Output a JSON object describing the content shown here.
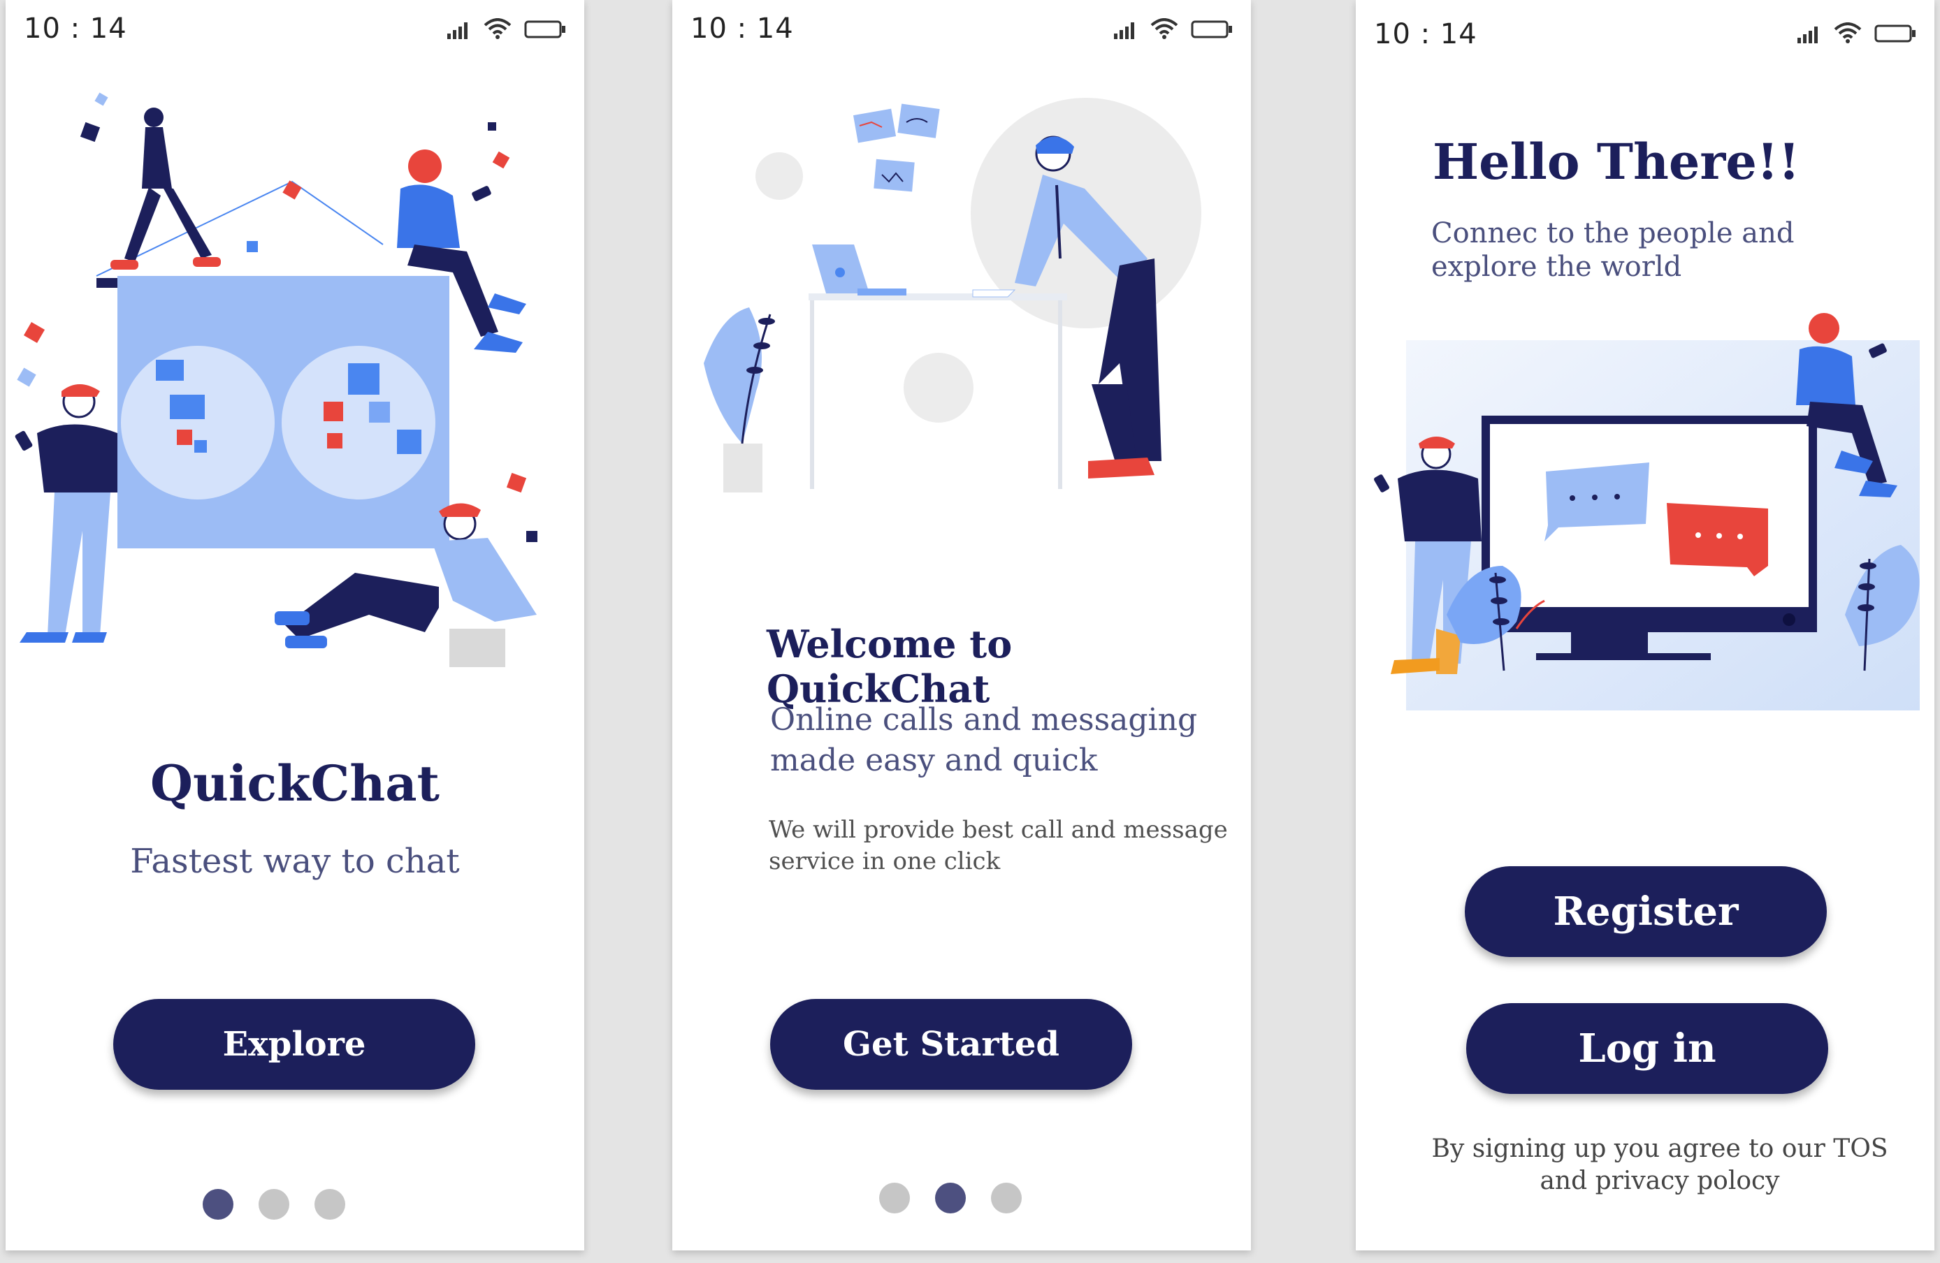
{
  "colors": {
    "primary": "#1c1f5b",
    "accent_blue": "#9cbcf5",
    "accent_red": "#e8453c",
    "dot_active": "#4d5080",
    "dot_inactive": "#c6c6c6"
  },
  "screens": [
    {
      "status": {
        "time": "10 : 14",
        "icons": [
          "signal-icon",
          "wifi-icon",
          "battery-icon"
        ]
      },
      "title": "QuickChat",
      "subtitle": "Fastest way to chat",
      "button_label": "Explore",
      "pagination": {
        "current": 1,
        "total": 3
      }
    },
    {
      "status": {
        "time": "10 : 14",
        "icons": [
          "signal-icon",
          "wifi-icon",
          "battery-icon"
        ]
      },
      "title": "Welcome to QuickChat",
      "subtitle": "Online calls and messaging made easy and quick",
      "body": "We will provide best call and message service in one click",
      "button_label": "Get Started",
      "pagination": {
        "current": 2,
        "total": 3
      }
    },
    {
      "status": {
        "time": "10 : 14",
        "icons": [
          "signal-icon",
          "wifi-icon",
          "battery-icon"
        ]
      },
      "title": "Hello There!!",
      "subtitle": "Connec to the people and explore the world",
      "register_label": "Register",
      "login_label": "Log in",
      "footer": "By signing up you agree to our TOS and privacy polocy"
    }
  ]
}
